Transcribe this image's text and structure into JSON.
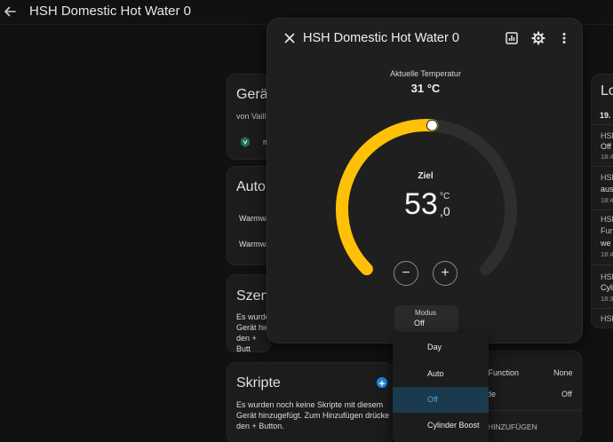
{
  "appbar": {
    "title": "HSH Domestic Hot Water 0",
    "back_icon": "arrow-left-icon"
  },
  "device_card": {
    "title": "Gerät",
    "subtitle": "von Vailla",
    "item_initial": "m"
  },
  "automations_card": {
    "title": "Autom",
    "rows": [
      "Warmwa",
      "Warmwa"
    ]
  },
  "scenes_card": {
    "title": "Szene",
    "lines": [
      "Es wurde",
      "Gerät hin",
      "den + Butt"
    ]
  },
  "scripts_card": {
    "title": "Skripte",
    "lines": [
      "Es wurden noch keine Skripte mit diesem",
      "Gerät hinzugefügt. Zum Hinzufügen drücke",
      "den + Button."
    ]
  },
  "attributes_card": {
    "rows": [
      {
        "label": "ial Function",
        "value": "None"
      },
      {
        "label": "ode",
        "value": "Off"
      }
    ],
    "action": "HINZUFÜGEN"
  },
  "logbook_card": {
    "title": "Lo",
    "date": "19.",
    "entries": [
      {
        "name": "HSH",
        "text": "Off",
        "time": "18:4"
      },
      {
        "name": "HSH",
        "text": "aus",
        "time": "18:4"
      },
      {
        "name": "HSH",
        "name2": "Fun",
        "text": "we",
        "time": "18:4"
      },
      {
        "name": "HSH",
        "text": "Cyli",
        "time": "18:3"
      },
      {
        "name": "HSH",
        "text": "",
        "time": ""
      }
    ]
  },
  "dialog": {
    "title": "HSH Domestic Hot Water 0",
    "current_label": "Aktuelle Temperatur",
    "current_value": "31 °C",
    "target_label": "Ziel",
    "target_integer": "53",
    "target_unit": "°C",
    "target_decimal": ",0",
    "target_value": 53.0,
    "dial_min": 35,
    "dial_max": 70,
    "minus_label": "−",
    "plus_label": "+",
    "mode_label": "Modus",
    "mode_value": "Off",
    "icons": [
      "close-icon",
      "history-chart-icon",
      "gear-icon",
      "more-vert-icon"
    ],
    "accent_color": "#ffc107",
    "track_color": "#2e2e2e"
  },
  "mode_menu": {
    "options": [
      "Day",
      "Auto",
      "Off",
      "Cylinder Boost"
    ],
    "selected": "Off",
    "selected_color": "#41a7e0"
  }
}
